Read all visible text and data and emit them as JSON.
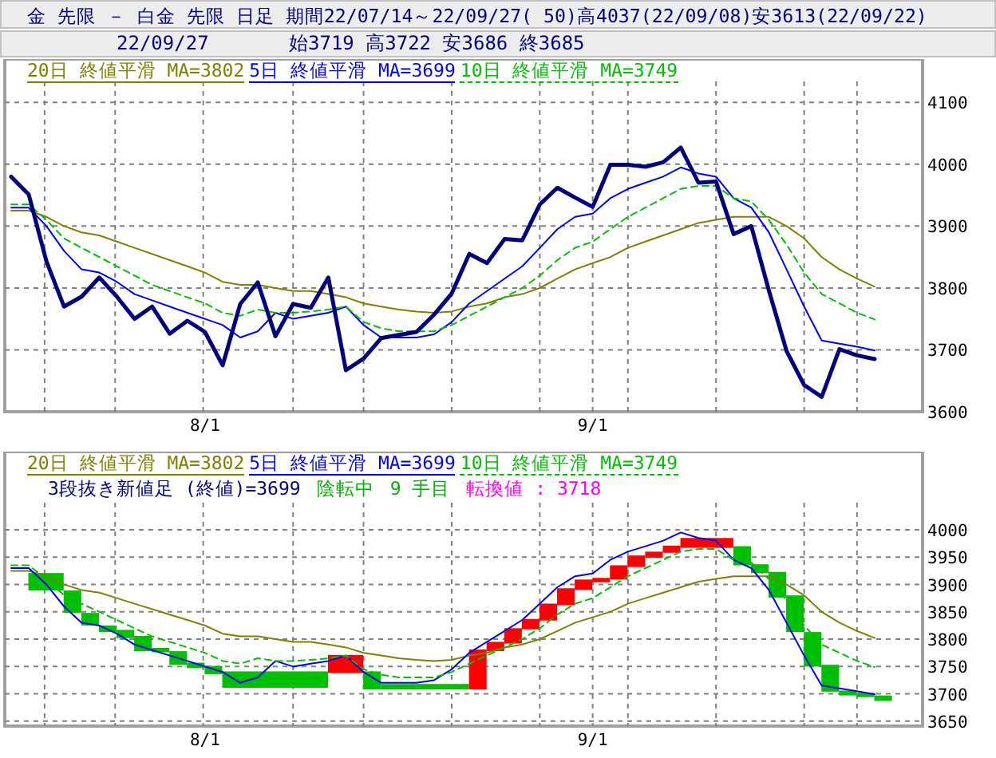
{
  "header": {
    "title": "金 先限 － 白金 先限 日足 期間22/07/14～22/09/27( 50)高4037(22/09/08)安3613(22/09/22)",
    "date": "22/09/27",
    "ohlc": "始3719 高3722 安3686 終3685"
  },
  "price_panel": {
    "chart_data": {
      "type": "line",
      "grid": true,
      "ylim": [
        3600,
        4170
      ],
      "yticks": [
        3600,
        3700,
        3800,
        3900,
        4000,
        4100
      ],
      "categories": [
        null,
        null,
        null,
        null,
        null,
        null,
        null,
        null,
        null,
        null,
        null,
        "8/1",
        null,
        null,
        null,
        null,
        null,
        null,
        null,
        null,
        null,
        null,
        null,
        null,
        null,
        null,
        null,
        null,
        null,
        null,
        null,
        null,
        null,
        "9/1",
        null,
        null,
        null,
        null,
        null,
        null,
        null,
        null,
        null,
        null,
        null,
        null,
        null,
        null,
        null,
        null
      ],
      "series": [
        {
          "name": "20日 終値平滑 MA=3802",
          "color": "#808000",
          "line_style": "solid",
          "values": [
            3925,
            3925,
            3915,
            3900,
            3890,
            3885,
            3875,
            3865,
            3855,
            3845,
            3835,
            3825,
            3810,
            3805,
            3805,
            3800,
            3795,
            3795,
            3790,
            3785,
            3775,
            3770,
            3765,
            3762,
            3760,
            3762,
            3770,
            3775,
            3785,
            3790,
            3800,
            3815,
            3830,
            3840,
            3850,
            3865,
            3875,
            3885,
            3895,
            3905,
            3910,
            3915,
            3915,
            3915,
            3900,
            3880,
            3850,
            3830,
            3815,
            3802
          ]
        },
        {
          "name": "5日 終値平滑 MA=3699",
          "color": "#0000ff",
          "line_style": "solid",
          "values": [
            3930,
            3930,
            3900,
            3860,
            3830,
            3825,
            3810,
            3790,
            3780,
            3770,
            3760,
            3750,
            3740,
            3720,
            3730,
            3760,
            3750,
            3755,
            3760,
            3770,
            3740,
            3720,
            3720,
            3720,
            3725,
            3745,
            3775,
            3795,
            3815,
            3835,
            3865,
            3895,
            3915,
            3920,
            3945,
            3960,
            3970,
            3980,
            3995,
            3985,
            3980,
            3945,
            3930,
            3890,
            3830,
            3770,
            3715,
            3710,
            3705,
            3699
          ]
        },
        {
          "name": "10日 終値平滑 MA=3749",
          "color": "#00c000",
          "line_style": "dashed",
          "values": [
            3935,
            3935,
            3910,
            3880,
            3865,
            3850,
            3835,
            3820,
            3805,
            3795,
            3785,
            3775,
            3760,
            3755,
            3765,
            3760,
            3760,
            3762,
            3765,
            3770,
            3745,
            3735,
            3730,
            3730,
            3730,
            3740,
            3755,
            3770,
            3785,
            3800,
            3820,
            3845,
            3865,
            3875,
            3895,
            3915,
            3930,
            3945,
            3960,
            3965,
            3965,
            3945,
            3940,
            3910,
            3870,
            3825,
            3790,
            3775,
            3760,
            3749
          ]
        },
        {
          "color": "#000080",
          "line_style": "solid",
          "values": [
            3980,
            3951,
            3843,
            3770,
            3786,
            3817,
            3786,
            3750,
            3770,
            3726,
            3747,
            3729,
            3675,
            3774,
            3809,
            3722,
            3774,
            3768,
            3817,
            3667,
            3686,
            3719,
            3724,
            3729,
            3757,
            3791,
            3855,
            3840,
            3879,
            3877,
            3935,
            3962,
            3946,
            3931,
            3999,
            3999,
            3996,
            4003,
            4027,
            3970,
            3972,
            3887,
            3900,
            3796,
            3698,
            3643,
            3624,
            3701,
            3691,
            3685
          ]
        }
      ]
    }
  },
  "brick_panel": {
    "status": [
      {
        "text": "3段抜き新値足 (終値)=3699",
        "color": "#000080"
      },
      {
        "text": "陰転中",
        "color": "#00b000"
      },
      {
        "text": "9 手目",
        "color": "#00b000"
      },
      {
        "text": "転換値 : 3718",
        "color": "#ff00ff"
      }
    ],
    "chart_data": {
      "type": "line",
      "grid": true,
      "ylim": [
        3641,
        4143
      ],
      "yticks": [
        3650,
        3700,
        3750,
        3800,
        3850,
        3900,
        3950,
        4000
      ],
      "categories": [
        null,
        null,
        null,
        null,
        null,
        null,
        null,
        null,
        null,
        null,
        null,
        "8/1",
        null,
        null,
        null,
        null,
        null,
        null,
        null,
        null,
        null,
        null,
        null,
        null,
        null,
        null,
        null,
        null,
        null,
        null,
        null,
        null,
        null,
        "9/1",
        null,
        null,
        null,
        null,
        null,
        null,
        null,
        null,
        null,
        null,
        null,
        null,
        null,
        null,
        null,
        null
      ],
      "series": [
        {
          "name": "20日 終値平滑 MA=3802",
          "color": "#808000",
          "line_style": "solid",
          "values": [
            3925,
            3925,
            3915,
            3900,
            3890,
            3885,
            3875,
            3865,
            3855,
            3845,
            3835,
            3825,
            3810,
            3805,
            3805,
            3800,
            3795,
            3795,
            3790,
            3785,
            3775,
            3770,
            3765,
            3762,
            3760,
            3762,
            3770,
            3775,
            3785,
            3790,
            3800,
            3815,
            3830,
            3840,
            3850,
            3865,
            3875,
            3885,
            3895,
            3905,
            3910,
            3915,
            3915,
            3915,
            3900,
            3880,
            3850,
            3830,
            3815,
            3802
          ]
        },
        {
          "name": "5日 終値平滑 MA=3699",
          "color": "#0000ff",
          "line_style": "solid",
          "values": [
            3930,
            3930,
            3900,
            3860,
            3830,
            3825,
            3810,
            3790,
            3780,
            3770,
            3760,
            3750,
            3740,
            3720,
            3730,
            3760,
            3750,
            3755,
            3760,
            3770,
            3740,
            3720,
            3720,
            3720,
            3725,
            3745,
            3775,
            3795,
            3815,
            3835,
            3865,
            3895,
            3915,
            3920,
            3945,
            3960,
            3970,
            3980,
            3995,
            3985,
            3980,
            3945,
            3930,
            3890,
            3830,
            3770,
            3715,
            3710,
            3705,
            3699
          ]
        },
        {
          "name": "10日 終値平滑 MA=3749",
          "color": "#00c000",
          "line_style": "dashed",
          "values": [
            3935,
            3935,
            3910,
            3880,
            3865,
            3850,
            3835,
            3820,
            3805,
            3795,
            3785,
            3775,
            3760,
            3755,
            3765,
            3760,
            3760,
            3762,
            3765,
            3770,
            3745,
            3735,
            3730,
            3730,
            3730,
            3740,
            3755,
            3770,
            3785,
            3800,
            3820,
            3845,
            3865,
            3875,
            3895,
            3915,
            3930,
            3945,
            3960,
            3965,
            3965,
            3945,
            3940,
            3910,
            3870,
            3825,
            3790,
            3775,
            3760,
            3749
          ]
        }
      ]
    },
    "kind": "picture"
  }
}
